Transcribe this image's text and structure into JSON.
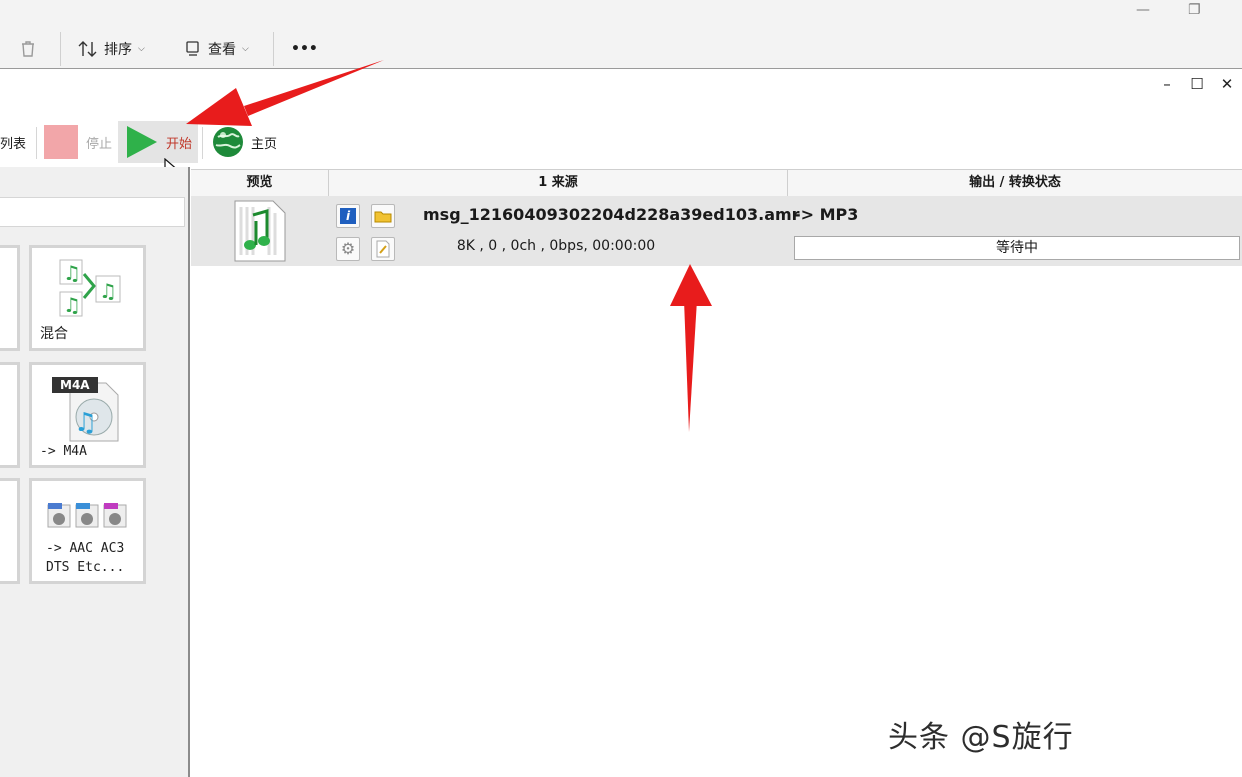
{
  "explorer": {
    "sort_label": "排序",
    "view_label": "查看",
    "more_label": "•••"
  },
  "toolbar": {
    "list_label": "列表",
    "stop_label": "停止",
    "start_label": "开始",
    "home_label": "主页"
  },
  "left_tiles": {
    "mix_label": "混合",
    "m4a_badge": "M4A",
    "m4a_label": "-> M4A",
    "aac_label": "-> AAC AC3\nDTS Etc..."
  },
  "table": {
    "columns": [
      "预览",
      "1 来源",
      "输出 / 转换状态"
    ],
    "rows": [
      {
        "filename": "msg_12160409302204d228a39ed103.amr",
        "meta": "8K , 0 , 0ch , 0bps, 00:00:00",
        "output_format": "-> MP3",
        "status": "等待中"
      }
    ]
  },
  "watermark": "头条 @S旋行",
  "colors": {
    "annotation_arrow": "#e81c1c",
    "start_text": "#c0392b",
    "stop_disabled": "#f2a6a9",
    "play_green": "#2fb14a"
  }
}
